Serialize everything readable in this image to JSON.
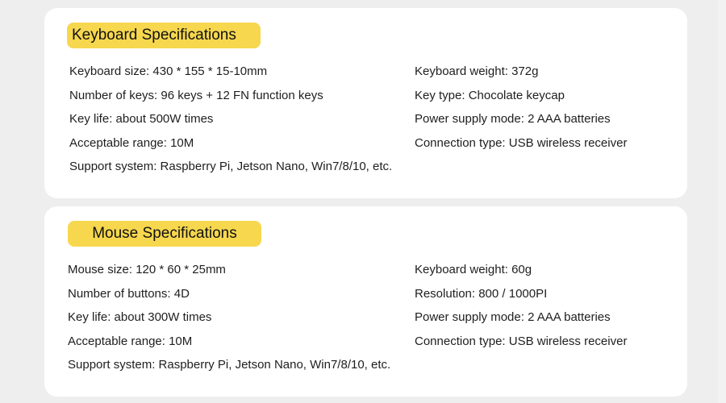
{
  "colors": {
    "background": "#eeeeee",
    "card": "#ffffff",
    "badge": "#f6d74e",
    "text": "#1e1e1e"
  },
  "keyboard": {
    "title": "Keyboard Specifications",
    "left": [
      "Keyboard size: 430 * 155 * 15-10mm",
      "Number of keys: 96 keys + 12 FN function keys",
      "Key life: about 500W times",
      "Acceptable range: 10M"
    ],
    "right": [
      "Keyboard weight: 372g",
      "Key type: Chocolate keycap",
      "Power supply mode: 2 AAA batteries",
      "Connection type: USB wireless receiver"
    ],
    "support": "Support system: Raspberry Pi, Jetson Nano, Win7/8/10, etc."
  },
  "mouse": {
    "title": "Mouse Specifications",
    "left": [
      "Mouse size: 120 * 60 * 25mm",
      "Number of buttons: 4D",
      "Key life: about 300W times",
      "Acceptable range: 10M"
    ],
    "right": [
      "Keyboard weight: 60g",
      "Resolution: 800 / 1000PI",
      "Power supply mode: 2 AAA batteries",
      "Connection type: USB wireless receiver"
    ],
    "support": "Support system: Raspberry Pi, Jetson Nano, Win7/8/10, etc."
  }
}
